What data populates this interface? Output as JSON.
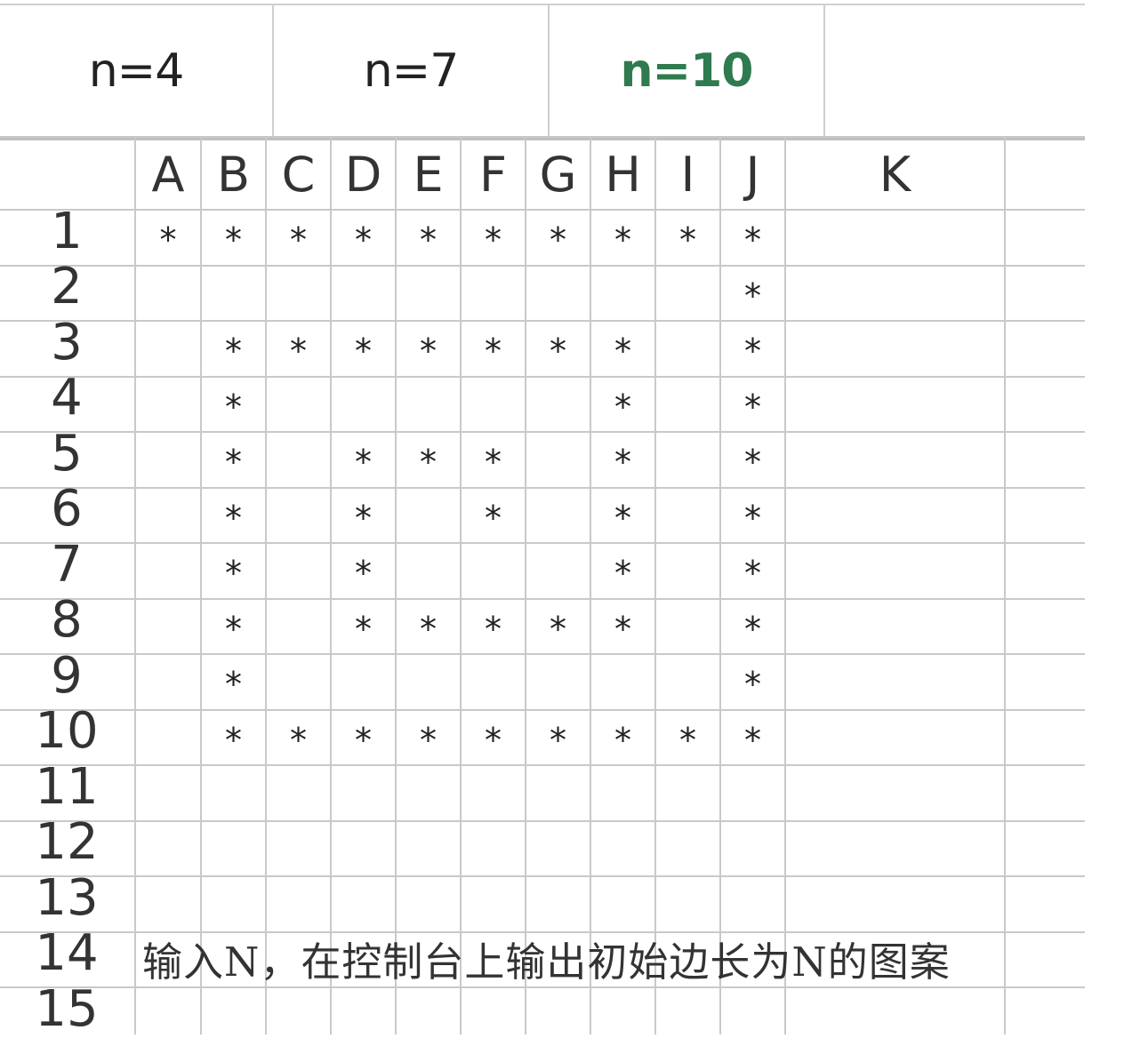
{
  "tabs": [
    {
      "label": "n=4",
      "active": false
    },
    {
      "label": "n=7",
      "active": false
    },
    {
      "label": "n=10",
      "active": true
    },
    {
      "label": "",
      "active": false
    }
  ],
  "colors": {
    "active_tab": "#2f7a4f",
    "grid_line": "#c9c9c9",
    "text": "#222222"
  },
  "sheet": {
    "columns": [
      "A",
      "B",
      "C",
      "D",
      "E",
      "F",
      "G",
      "H",
      "I",
      "J",
      "K"
    ],
    "rows": [
      "1",
      "2",
      "3",
      "4",
      "5",
      "6",
      "7",
      "8",
      "9",
      "10",
      "11",
      "12",
      "13",
      "14",
      "15"
    ],
    "cells": [
      [
        "*",
        "*",
        "*",
        "*",
        "*",
        "*",
        "*",
        "*",
        "*",
        "*",
        ""
      ],
      [
        "",
        "",
        "",
        "",
        "",
        "",
        "",
        "",
        "",
        "*",
        ""
      ],
      [
        "",
        "*",
        "*",
        "*",
        "*",
        "*",
        "*",
        "*",
        "",
        "*",
        ""
      ],
      [
        "",
        "*",
        "",
        "",
        "",
        "",
        "",
        "*",
        "",
        "*",
        ""
      ],
      [
        "",
        "*",
        "",
        "*",
        "*",
        "*",
        "",
        "*",
        "",
        "*",
        ""
      ],
      [
        "",
        "*",
        "",
        "*",
        "",
        "*",
        "",
        "*",
        "",
        "*",
        ""
      ],
      [
        "",
        "*",
        "",
        "*",
        "",
        "",
        "",
        "*",
        "",
        "*",
        ""
      ],
      [
        "",
        "*",
        "",
        "*",
        "*",
        "*",
        "*",
        "*",
        "",
        "*",
        ""
      ],
      [
        "",
        "*",
        "",
        "",
        "",
        "",
        "",
        "",
        "",
        "*",
        ""
      ],
      [
        "",
        "*",
        "*",
        "*",
        "*",
        "*",
        "*",
        "*",
        "*",
        "*",
        ""
      ],
      [
        "",
        "",
        "",
        "",
        "",
        "",
        "",
        "",
        "",
        "",
        ""
      ],
      [
        "",
        "",
        "",
        "",
        "",
        "",
        "",
        "",
        "",
        "",
        ""
      ],
      [
        "",
        "",
        "",
        "",
        "",
        "",
        "",
        "",
        "",
        "",
        ""
      ],
      [
        "",
        "",
        "",
        "",
        "",
        "",
        "",
        "",
        "",
        "",
        ""
      ],
      [
        "",
        "",
        "",
        "",
        "",
        "",
        "",
        "",
        "",
        "",
        ""
      ]
    ],
    "note": {
      "row": 14,
      "text": "输入N，在控制台上输出初始边长为N的图案"
    }
  }
}
